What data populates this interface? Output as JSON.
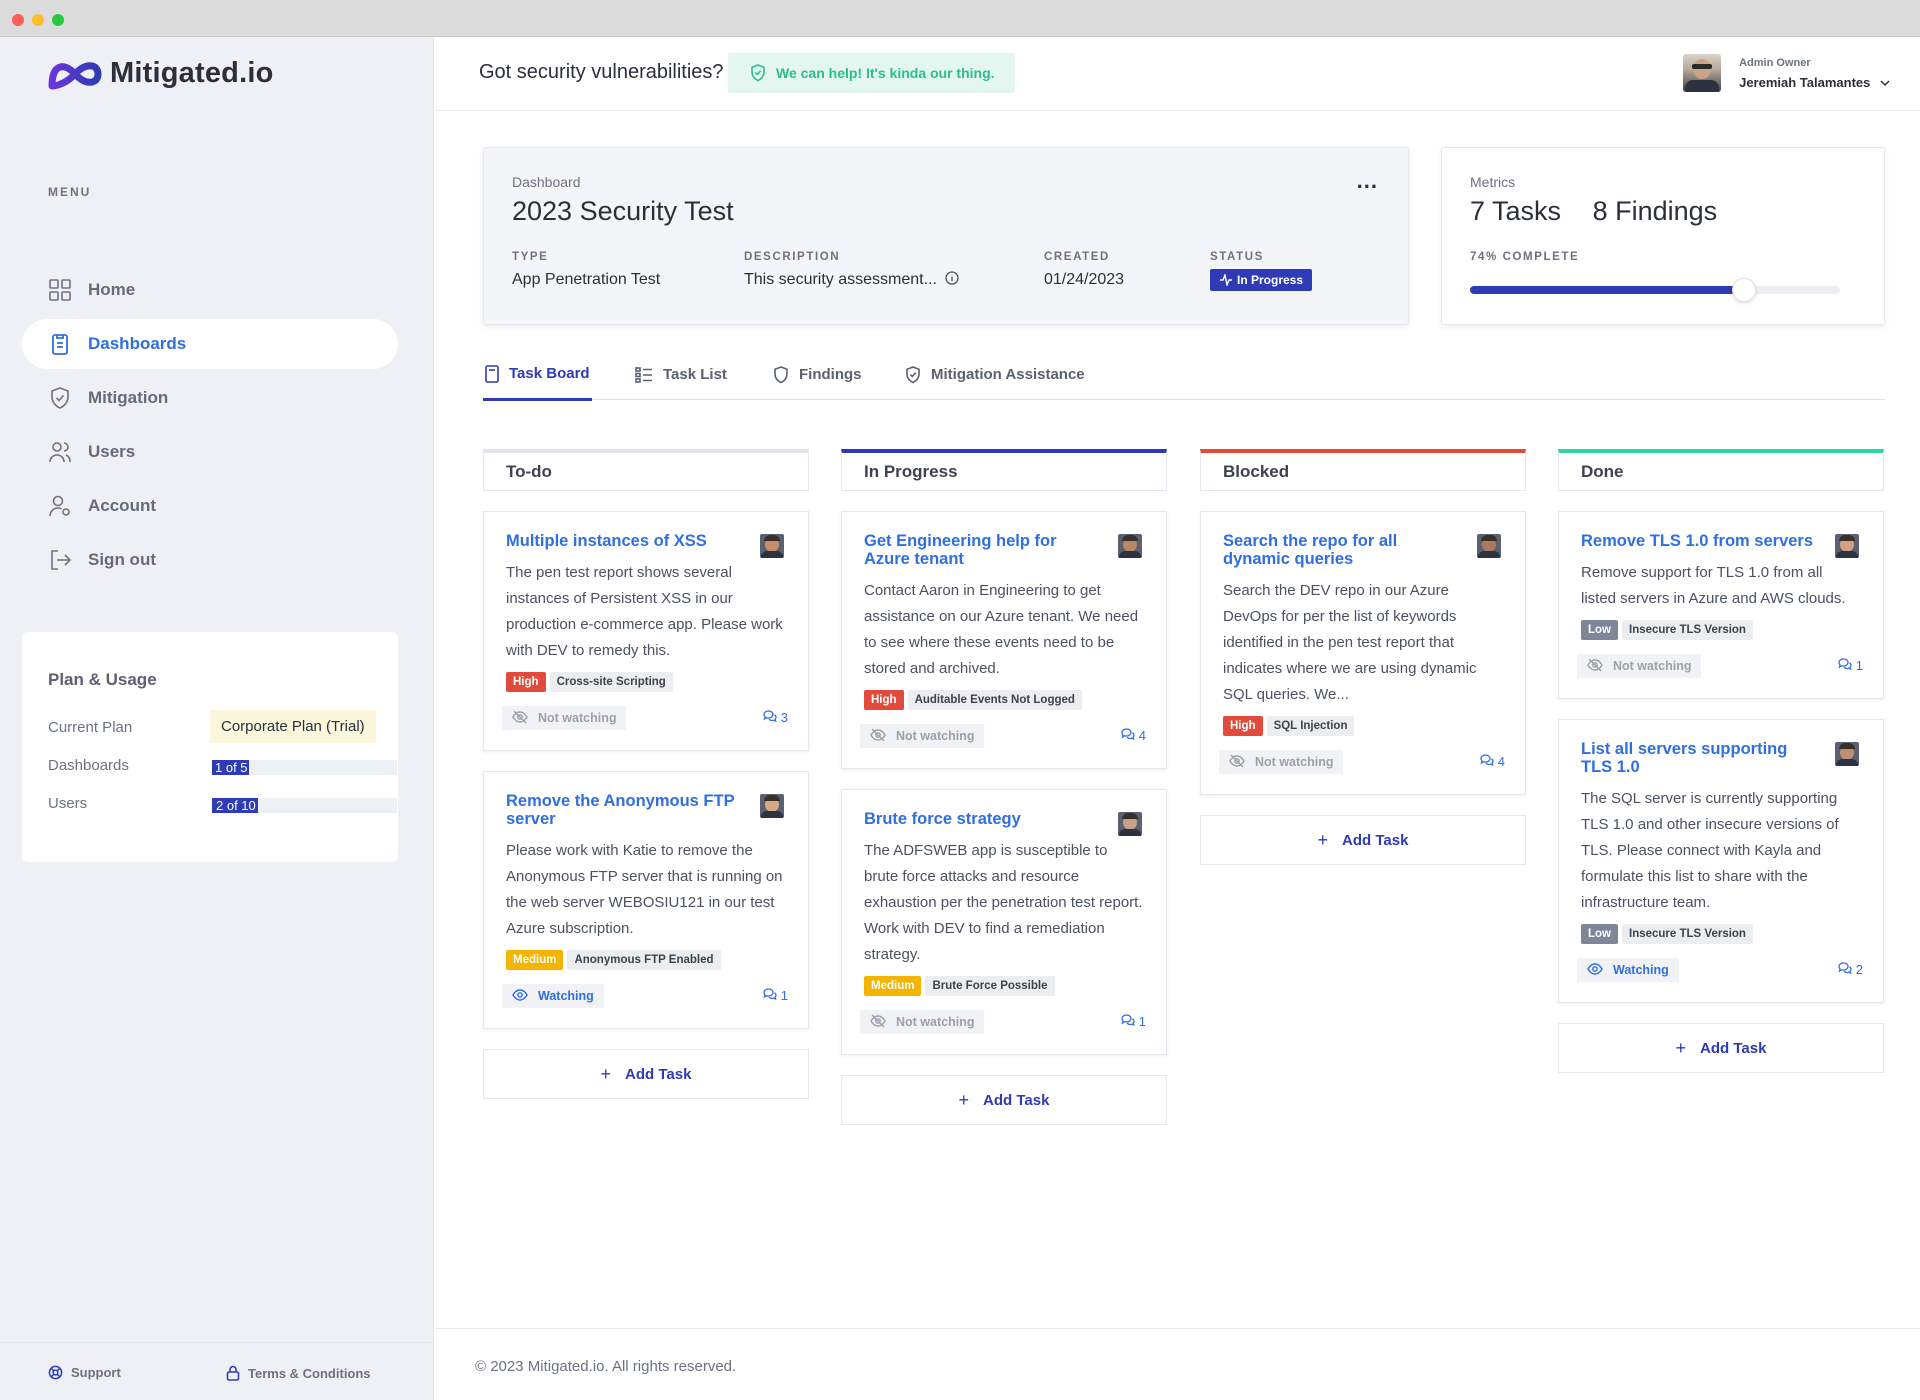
{
  "app": {
    "name": "Mitigated.io"
  },
  "sidebar": {
    "menu_heading": "MENU",
    "items": [
      {
        "label": "Home"
      },
      {
        "label": "Dashboards"
      },
      {
        "label": "Mitigation"
      },
      {
        "label": "Users"
      },
      {
        "label": "Account"
      },
      {
        "label": "Sign out"
      }
    ],
    "active": "Dashboards",
    "plan": {
      "title": "Plan & Usage",
      "current_plan_label": "Current Plan",
      "current_plan_value": "Corporate Plan (Trial)",
      "dashboards_label": "Dashboards",
      "dashboards_value": "1 of 5",
      "dashboards_fraction": 0.2,
      "users_label": "Users",
      "users_value": "2 of 10",
      "users_fraction": 0.2
    },
    "footer": {
      "support": "Support",
      "terms": "Terms & Conditions"
    }
  },
  "topbar": {
    "tagline": "Got security vulnerabilities?",
    "help_badge": "We can help! It's kinda our thing.",
    "user_role": "Admin Owner",
    "user_name": "Jeremiah Talamantes"
  },
  "dashboard": {
    "kicker": "Dashboard",
    "title": "2023 Security Test",
    "type_label": "TYPE",
    "type_value": "App Penetration Test",
    "description_label": "DESCRIPTION",
    "description_value": "This security assessment...",
    "created_label": "CREATED",
    "created_value": "01/24/2023",
    "status_label": "STATUS",
    "status_value": "In Progress",
    "more_menu": "..."
  },
  "metrics": {
    "kicker": "Metrics",
    "tasks": "7 Tasks",
    "findings": "8 Findings",
    "complete_label": "74% COMPLETE",
    "complete_fraction": 0.74
  },
  "tabs": [
    {
      "label": "Task Board",
      "active": true
    },
    {
      "label": "Task List"
    },
    {
      "label": "Findings"
    },
    {
      "label": "Mitigation Assistance"
    }
  ],
  "board": {
    "add_task_label": "Add Task",
    "columns": [
      {
        "title": "To-do",
        "color": "#e1e4ea",
        "tasks": [
          {
            "title": "Multiple instances of XSS",
            "desc": "The pen test report shows several instances of Persistent XSS in our production e-commerce app. Please work with DEV to remedy this.",
            "severity": "High",
            "category": "Cross-site Scripting",
            "watch": "Not watching",
            "watching": false,
            "comments": "3"
          },
          {
            "title": "Remove the Anonymous FTP server",
            "desc": "Please work with Katie to remove the Anonymous FTP server that is running on the web server WEBOSIU121 in our test Azure subscription.",
            "severity": "Medium",
            "category": "Anonymous FTP Enabled",
            "watch": "Watching",
            "watching": true,
            "comments": "1"
          }
        ]
      },
      {
        "title": "In Progress",
        "color": "#2e3bb4",
        "tasks": [
          {
            "title": "Get Engineering help for Azure tenant",
            "desc": "Contact Aaron in Engineering to get assistance on our Azure tenant. We need to see where these events need to be stored and archived.",
            "severity": "High",
            "category": "Auditable Events Not Logged",
            "watch": "Not watching",
            "watching": false,
            "comments": "4"
          },
          {
            "title": "Brute force strategy",
            "desc": "The ADFSWEB app is susceptible to brute force attacks and resource exhaustion per the penetration test report. Work with DEV to find a remediation strategy.",
            "severity": "Medium",
            "category": "Brute Force Possible",
            "watch": "Not watching",
            "watching": false,
            "comments": "1"
          }
        ]
      },
      {
        "title": "Blocked",
        "color": "#e24a3b",
        "tasks": [
          {
            "title": "Search the repo for all dynamic queries",
            "desc": "Search the DEV repo in our Azure DevOps for per the list of keywords identified in the pen test report that indicates where we are using dynamic SQL queries. We...",
            "severity": "High",
            "category": "SQL Injection",
            "watch": "Not watching",
            "watching": false,
            "comments": "4"
          }
        ]
      },
      {
        "title": "Done",
        "color": "#2fd3a4",
        "tasks": [
          {
            "title": "Remove TLS 1.0 from servers",
            "desc": "Remove support for TLS 1.0 from all listed servers in Azure and AWS clouds.",
            "severity": "Low",
            "category": "Insecure TLS Version",
            "watch": "Not watching",
            "watching": false,
            "comments": "1"
          },
          {
            "title": "List all servers supporting TLS 1.0",
            "desc": "The SQL server is currently supporting TLS 1.0 and other insecure versions of TLS. Please connect with Kayla and formulate this list to share with the infrastructure team.",
            "severity": "Low",
            "category": "Insecure TLS Version",
            "watch": "Watching",
            "watching": true,
            "comments": "2"
          }
        ]
      }
    ]
  },
  "footer": {
    "copyright": "© 2023 Mitigated.io. All rights reserved."
  },
  "colors": {
    "accent": "#2e3bb4",
    "link": "#2f6fe0",
    "high": "#e24a3b",
    "medium": "#f4b400",
    "low": "#7d8797",
    "success": "#2cbf8a"
  }
}
